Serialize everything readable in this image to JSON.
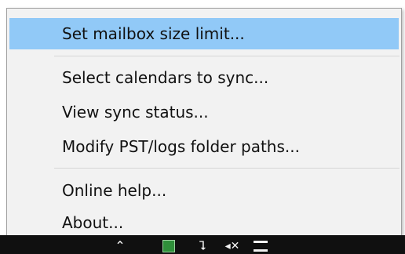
{
  "menu": {
    "items": [
      {
        "label": "Set mailbox size limit...",
        "selected": true
      },
      {
        "label": "Select calendars to sync..."
      },
      {
        "label": "View sync status..."
      },
      {
        "label": "Modify PST/logs folder paths..."
      },
      {
        "label": "Online help..."
      },
      {
        "label": "About..."
      }
    ]
  },
  "colors": {
    "menu_background": "#f2f2f2",
    "selection_highlight": "#91c9f7",
    "taskbar": "#101010"
  },
  "taskbar": {
    "tray_icons": [
      "chevron-up-icon",
      "app-tray-icon",
      "network-icon",
      "volume-icon",
      "notes-icon"
    ]
  }
}
